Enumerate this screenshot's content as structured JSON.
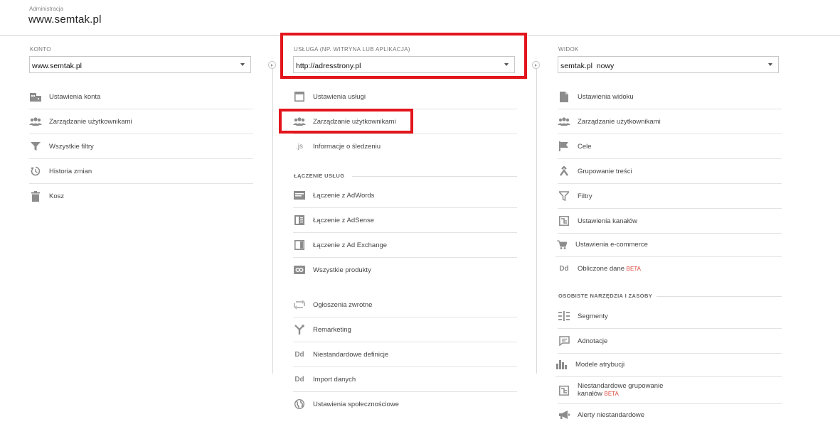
{
  "header": {
    "sup": "Administracja",
    "title": "www.semtak.pl"
  },
  "account": {
    "label": "KONTO",
    "selected": "www.semtak.pl",
    "items": [
      {
        "label": "Ustawienia konta",
        "icon": "building-icon"
      },
      {
        "label": "Zarządzanie użytkownikami",
        "icon": "users-icon"
      },
      {
        "label": "Wszystkie filtry",
        "icon": "filter-icon"
      },
      {
        "label": "Historia zmian",
        "icon": "history-icon"
      },
      {
        "label": "Kosz",
        "icon": "trash-icon"
      }
    ]
  },
  "property": {
    "label": "USŁUGA (NP. WITRYNA LUB APLIKACJA)",
    "selected": "http://adresstrony.pl",
    "items": [
      {
        "label": "Ustawienia usługi",
        "icon": "window-icon"
      },
      {
        "label": "Zarządzanie użytkownikami",
        "icon": "users-icon"
      },
      {
        "label": "Informacje o śledzeniu",
        "icon": "js-icon",
        "icon_text": ".js"
      }
    ],
    "section_linking": "ŁĄCZENIE USŁUG",
    "linking_items": [
      {
        "label": "Łączenie z AdWords",
        "icon": "adwords-icon"
      },
      {
        "label": "Łączenie z AdSense",
        "icon": "adsense-icon"
      },
      {
        "label": "Łączenie z Ad Exchange",
        "icon": "adexchange-icon"
      },
      {
        "label": "Wszystkie produkty",
        "icon": "link-icon"
      }
    ],
    "more_items": [
      {
        "label": "Ogłoszenia zwrotne",
        "icon": "postback-icon"
      },
      {
        "label": "Remarketing",
        "icon": "remarketing-icon"
      },
      {
        "label": "Niestandardowe definicje",
        "icon": "dd-icon",
        "icon_text": "Dd"
      },
      {
        "label": "Import danych",
        "icon": "dd-icon",
        "icon_text": "Dd"
      },
      {
        "label": "Ustawienia społecznościowe",
        "icon": "globe-icon"
      }
    ]
  },
  "view": {
    "label": "WIDOK",
    "selected": "semtak.pl  nowy",
    "items": [
      {
        "label": "Ustawienia widoku",
        "icon": "document-icon"
      },
      {
        "label": "Zarządzanie użytkownikami",
        "icon": "users-icon"
      },
      {
        "label": "Cele",
        "icon": "flag-icon"
      },
      {
        "label": "Grupowanie treści",
        "icon": "grouping-icon"
      },
      {
        "label": "Filtry",
        "icon": "filter-icon"
      },
      {
        "label": "Ustawienia kanałów",
        "icon": "channels-icon"
      },
      {
        "label": "Ustawienia e-commerce",
        "icon": "cart-icon"
      },
      {
        "label": "Obliczone dane",
        "beta": "BETA",
        "icon": "dd-icon",
        "icon_text": "Dd"
      }
    ],
    "section_personal": "OSOBISTE NARZĘDZIA I ZASOBY",
    "personal_items": [
      {
        "label": "Segmenty",
        "icon": "segments-icon"
      },
      {
        "label": "Adnotacje",
        "icon": "annotation-icon"
      },
      {
        "label": "Modele atrybucji",
        "icon": "bars-icon"
      },
      {
        "label_line1": "Niestandardowe grupowanie",
        "label_line2": "kanałów",
        "beta": "BETA",
        "icon": "channels-icon"
      },
      {
        "label": "Alerty niestandardowe",
        "icon": "megaphone-icon"
      }
    ]
  },
  "colors": {
    "highlight": "#e3151c",
    "beta": "#e0483e"
  }
}
